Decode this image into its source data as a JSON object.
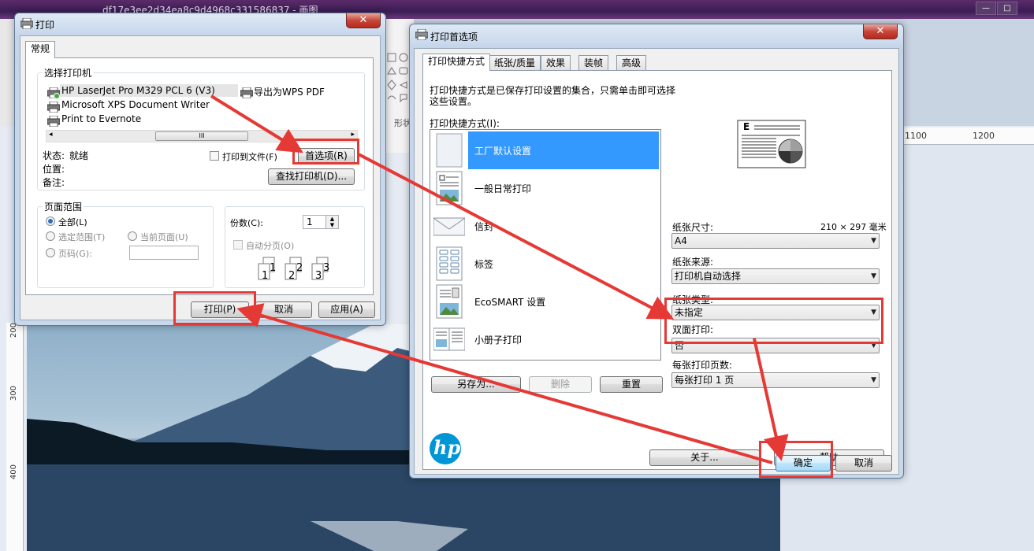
{
  "background_app": {
    "title": "df17e3ee2d34ea8c9d4968c331586837 - 画图",
    "ruler_top": [
      "1100",
      "1200"
    ],
    "ruler_left": [
      "200",
      "300",
      "400"
    ],
    "toolbar_label": "形状"
  },
  "print_dialog": {
    "title": "打印",
    "close_label": "✕",
    "tab_general": "常规",
    "select_printer_label": "选择打印机",
    "printers": [
      "HP LaserJet Pro M329 PCL 6 (V3)",
      "导出为WPS PDF",
      "Microsoft XPS Document Writer",
      "Print to Evernote"
    ],
    "scroll_thumb": "III",
    "status_label": "状态:",
    "status_value": "就绪",
    "location_label": "位置:",
    "comment_label": "备注:",
    "print_to_file_label": "打印到文件(F)",
    "preferences_button": "首选项(R)",
    "find_printer_button": "查找打印机(D)...",
    "page_range_label": "页面范围",
    "range_all": "全部(L)",
    "range_selection": "选定范围(T)",
    "range_current": "当前页面(U)",
    "range_pages": "页码(G):",
    "copies_label": "份数(C):",
    "copies_value": "1",
    "collate_label": "自动分页(O)",
    "collate_digits": [
      "1",
      "1",
      "2",
      "2",
      "3",
      "3"
    ],
    "print_button": "打印(P)",
    "cancel_button": "取消",
    "apply_button": "应用(A)"
  },
  "prefs_dialog": {
    "title": "打印首选项",
    "close_label": "✕",
    "tabs": [
      "打印快捷方式",
      "纸张/质量",
      "效果",
      "装帧",
      "高级"
    ],
    "description_line1": "打印快捷方式是已保存打印设置的集合，只需单击即可选择",
    "description_line2": "这些设置。",
    "shortcuts_label": "打印快捷方式(I):",
    "shortcuts": [
      "工厂默认设置",
      "一般日常打印",
      "信封",
      "标签",
      "EcoSMART 设置",
      "小册子打印"
    ],
    "save_as_button": "另存为...",
    "delete_button": "删除",
    "reset_button": "重置",
    "preview_letter": "E",
    "paper_size_label": "纸张尺寸:",
    "paper_size_dims": "210 × 297 毫米",
    "paper_size_value": "A4",
    "paper_source_label": "纸张来源:",
    "paper_source_value": "打印机自动选择",
    "paper_type_label": "纸张类型:",
    "paper_type_value": "未指定",
    "duplex_label": "双面打印:",
    "duplex_value": "否",
    "pages_per_sheet_label": "每张打印页数:",
    "pages_per_sheet_value": "每张打印 1 页",
    "logo_text": "hp",
    "about_button": "关于...",
    "help_button": "帮助",
    "ok_button": "确定",
    "cancel_button": "取消"
  },
  "colors": {
    "highlight": "#e53935",
    "selection": "#3399ff",
    "hp_blue": "#0096d6"
  }
}
